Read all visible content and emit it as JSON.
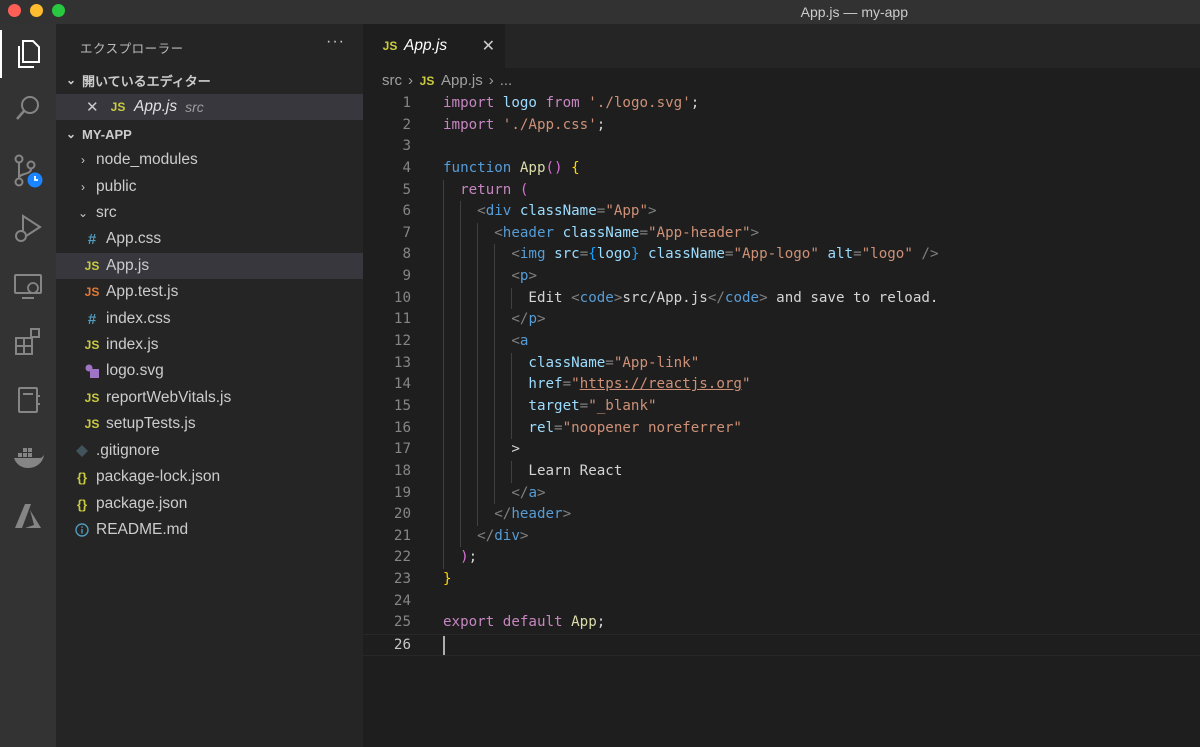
{
  "window": {
    "title": "App.js — my-app"
  },
  "activity": [
    "files-icon",
    "search-icon",
    "source-control-icon",
    "run-debug-icon",
    "remote-explorer-icon",
    "extensions-icon",
    "notebook-icon",
    "docker-icon",
    "azure-icon"
  ],
  "sidebar": {
    "title": "エクスプローラー",
    "open_editors": {
      "label": "開いているエディター",
      "items": [
        {
          "name": "App.js",
          "path": "src"
        }
      ]
    },
    "project": {
      "label": "MY-APP",
      "items": [
        {
          "name": "node_modules",
          "type": "folder"
        },
        {
          "name": "public",
          "type": "folder"
        },
        {
          "name": "src",
          "type": "folder-open"
        },
        {
          "name": "App.css",
          "type": "css"
        },
        {
          "name": "App.js",
          "type": "js"
        },
        {
          "name": "App.test.js",
          "type": "js"
        },
        {
          "name": "index.css",
          "type": "css"
        },
        {
          "name": "index.js",
          "type": "js"
        },
        {
          "name": "logo.svg",
          "type": "svg"
        },
        {
          "name": "reportWebVitals.js",
          "type": "js"
        },
        {
          "name": "setupTests.js",
          "type": "js"
        },
        {
          "name": ".gitignore",
          "type": "git"
        },
        {
          "name": "package-lock.json",
          "type": "json"
        },
        {
          "name": "package.json",
          "type": "json"
        },
        {
          "name": "README.md",
          "type": "info"
        }
      ]
    }
  },
  "editor": {
    "tab": {
      "label": "App.js",
      "icon_label": "JS"
    },
    "breadcrumb": {
      "folder": "src",
      "file": "App.js",
      "more": "..."
    },
    "current_line": 26,
    "lines": [
      "import logo from './logo.svg';",
      "import './App.css';",
      "",
      "function App() {",
      "  return (",
      "    <div className=\"App\">",
      "      <header className=\"App-header\">",
      "        <img src={logo} className=\"App-logo\" alt=\"logo\" />",
      "        <p>",
      "          Edit <code>src/App.js</code> and save to reload.",
      "        </p>",
      "        <a",
      "          className=\"App-link\"",
      "          href=\"https://reactjs.org\"",
      "          target=\"_blank\"",
      "          rel=\"noopener noreferrer\"",
      "        >",
      "          Learn React",
      "        </a>",
      "      </header>",
      "    </div>",
      "  );",
      "}",
      "",
      "export default App;",
      ""
    ]
  },
  "colors": {
    "keyword": "#c586c0",
    "function": "#dcdcaa",
    "variable": "#9cdcfe",
    "string": "#ce9178",
    "tag": "#569cd6",
    "js_icon": "#cbcb41",
    "css_icon": "#519aba",
    "svg_icon": "#a074c4",
    "git_icon": "#41535b"
  }
}
